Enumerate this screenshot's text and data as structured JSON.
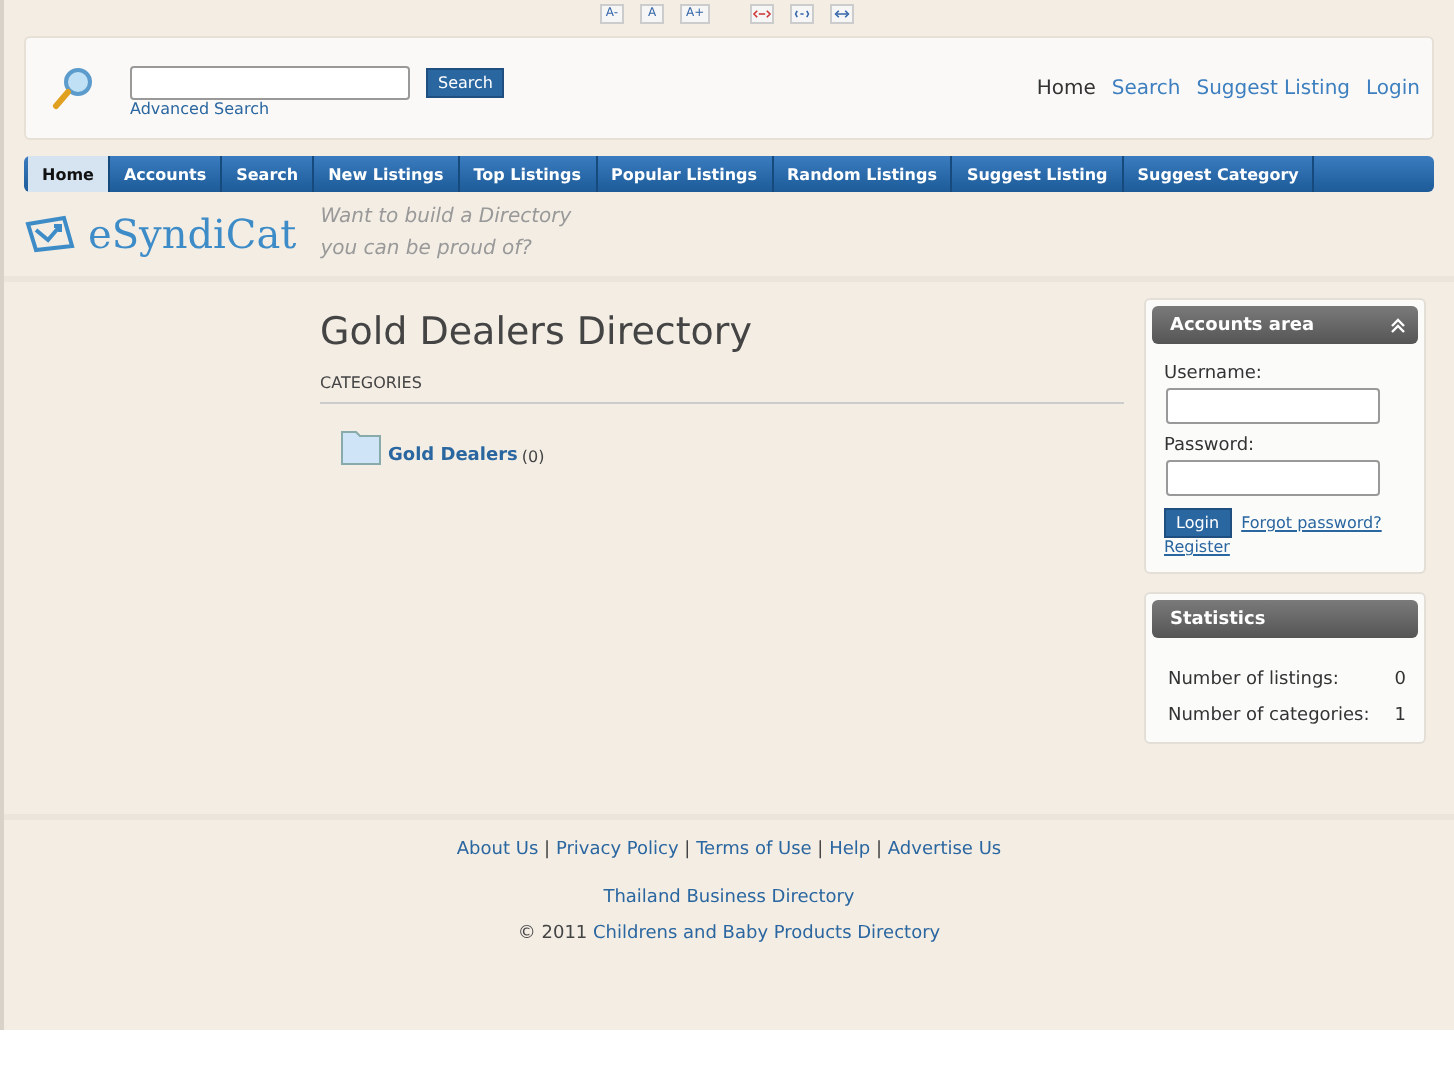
{
  "font_controls": [
    {
      "label": "A-"
    },
    {
      "label": "A"
    },
    {
      "label": "A+"
    }
  ],
  "width_controls": [
    {
      "kind": "narrow"
    },
    {
      "kind": "normal"
    },
    {
      "kind": "wide"
    }
  ],
  "search": {
    "button": "Search",
    "advanced": "Advanced Search"
  },
  "top_links": [
    {
      "label": "Home",
      "selected": true
    },
    {
      "label": "Search",
      "selected": false
    },
    {
      "label": "Suggest Listing",
      "selected": false
    },
    {
      "label": "Login",
      "selected": false
    }
  ],
  "nav": [
    {
      "label": "Home",
      "selected": true
    },
    {
      "label": "Accounts",
      "selected": false
    },
    {
      "label": "Search",
      "selected": false
    },
    {
      "label": "New Listings",
      "selected": false
    },
    {
      "label": "Top Listings",
      "selected": false
    },
    {
      "label": "Popular Listings",
      "selected": false
    },
    {
      "label": "Random Listings",
      "selected": false
    },
    {
      "label": "Suggest Listing",
      "selected": false
    },
    {
      "label": "Suggest Category",
      "selected": false
    }
  ],
  "logo": {
    "name": "eSyndiCat",
    "tagline": [
      "Want to build a Directory",
      "you can be proud of?"
    ]
  },
  "main": {
    "title": "Gold Dealers Directory",
    "section": "CATEGORIES",
    "categories": [
      {
        "name": "Gold Dealers",
        "count": "(0)"
      }
    ]
  },
  "accounts": {
    "title": "Accounts area",
    "expanded": true,
    "username_label": "Username:",
    "password_label": "Password:",
    "login": "Login",
    "forgot": "Forgot password?",
    "register": "Register"
  },
  "statistics": {
    "title": "Statistics",
    "rows": [
      {
        "label": "Number of listings:",
        "value": "0"
      },
      {
        "label": "Number of categories:",
        "value": "1"
      }
    ]
  },
  "footer": {
    "separator": "|",
    "links": [
      "About Us",
      "Privacy Policy",
      "Terms of Use",
      "Help",
      "Advertise Us"
    ],
    "directory": "Thailand Business Directory",
    "copyright": "© 2011",
    "copyright_link": "Childrens and Baby Products Directory"
  }
}
